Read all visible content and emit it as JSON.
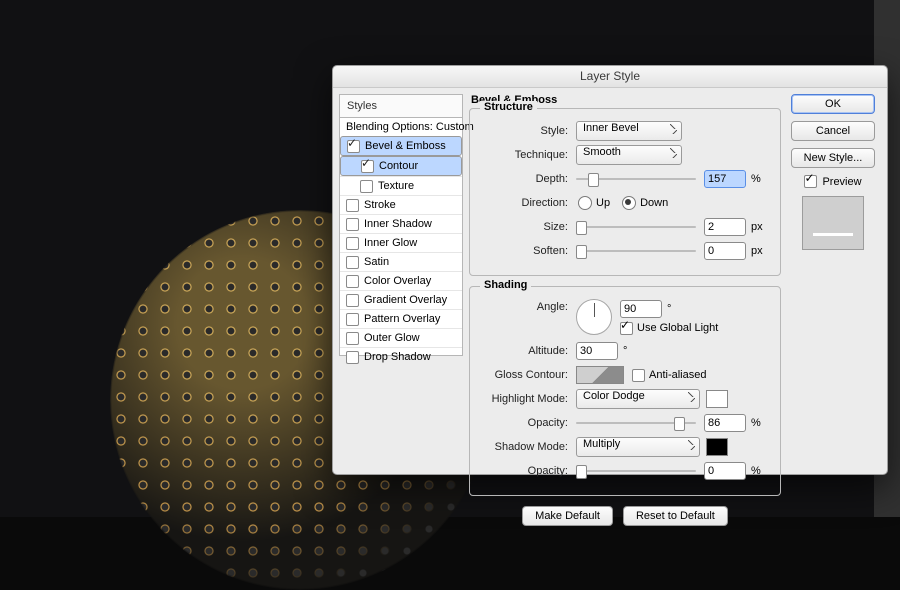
{
  "dialog": {
    "title": "Layer Style"
  },
  "styles_header": "Styles",
  "styles": {
    "blending": "Blending Options: Custom",
    "bevel": "Bevel & Emboss",
    "contour": "Contour",
    "texture": "Texture",
    "stroke": "Stroke",
    "inner_shadow": "Inner Shadow",
    "inner_glow": "Inner Glow",
    "satin": "Satin",
    "color_overlay": "Color Overlay",
    "gradient_overlay": "Gradient Overlay",
    "pattern_overlay": "Pattern Overlay",
    "outer_glow": "Outer Glow",
    "drop_shadow": "Drop Shadow"
  },
  "section_title": "Bevel & Emboss",
  "structure": {
    "legend": "Structure",
    "style_label": "Style:",
    "style_value": "Inner Bevel",
    "technique_label": "Technique:",
    "technique_value": "Smooth",
    "depth_label": "Depth:",
    "depth_value": "157",
    "depth_unit": "%",
    "direction_label": "Direction:",
    "dir_up": "Up",
    "dir_down": "Down",
    "size_label": "Size:",
    "size_value": "2",
    "size_unit": "px",
    "soften_label": "Soften:",
    "soften_value": "0",
    "soften_unit": "px"
  },
  "shading": {
    "legend": "Shading",
    "angle_label": "Angle:",
    "angle_value": "90",
    "angle_unit": "°",
    "global_light": "Use Global Light",
    "altitude_label": "Altitude:",
    "altitude_value": "30",
    "altitude_unit": "°",
    "gloss_label": "Gloss Contour:",
    "antialiased": "Anti-aliased",
    "highlight_mode_label": "Highlight Mode:",
    "highlight_mode_value": "Color Dodge",
    "highlight_color": "#ffffff",
    "hi_opacity_label": "Opacity:",
    "hi_opacity_value": "86",
    "hi_opacity_unit": "%",
    "shadow_mode_label": "Shadow Mode:",
    "shadow_mode_value": "Multiply",
    "shadow_color": "#000000",
    "sh_opacity_label": "Opacity:",
    "sh_opacity_value": "0",
    "sh_opacity_unit": "%"
  },
  "buttons": {
    "make_default": "Make Default",
    "reset_default": "Reset to Default",
    "ok": "OK",
    "cancel": "Cancel",
    "new_style": "New Style...",
    "preview": "Preview"
  }
}
